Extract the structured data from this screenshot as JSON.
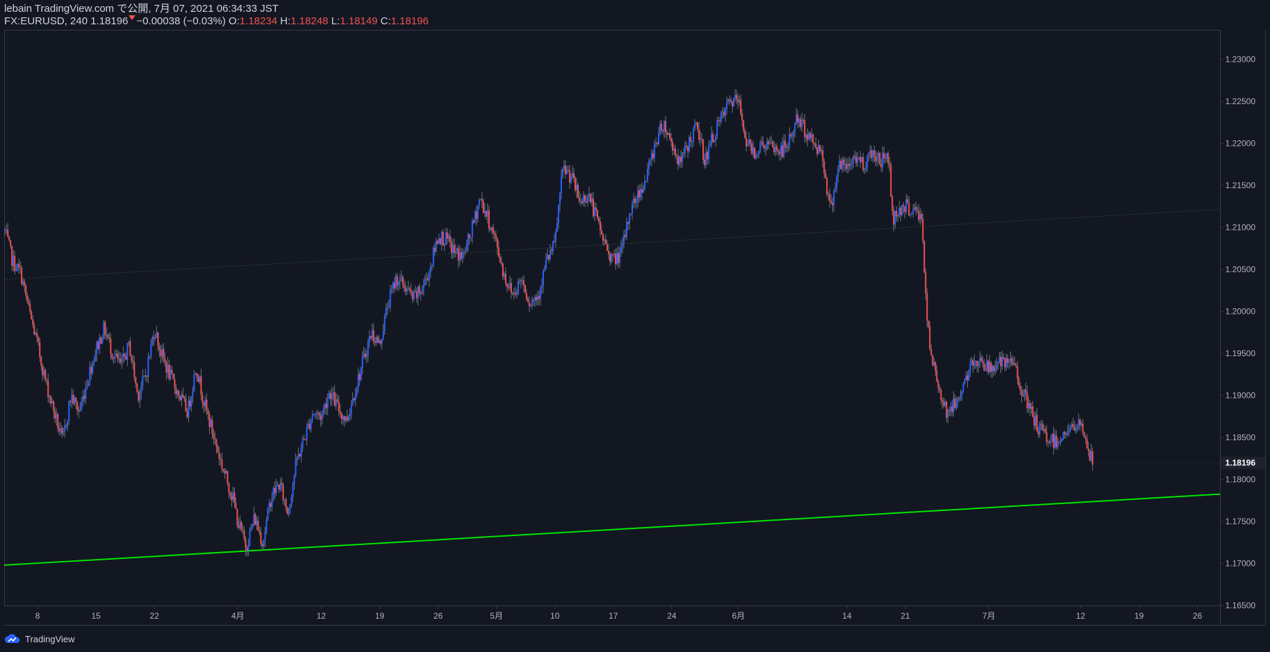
{
  "header": {
    "line1": "lebain TradingView.com で公開, 7月 07, 2021 06:34:33 JST",
    "symbol_prefix": "FX:EURUSD, 240 1.18196",
    "change": "−0.00038 (−0.03%)",
    "o_label": "O:",
    "o_value": "1.18234",
    "h_label": "H:",
    "h_value": "1.18248",
    "l_label": "L:",
    "l_value": "1.18149",
    "c_label": "C:",
    "c_value": "1.18196"
  },
  "footer": {
    "brand": "TradingView"
  },
  "colors": {
    "background": "#131722",
    "up": "#2962ff",
    "down": "#ef5350",
    "trendline": "#00e600",
    "channel_line": "#2e7d32",
    "price_tag": "#1e222d",
    "axis_text": "#b2b5be"
  },
  "chart_data": {
    "type": "candlestick",
    "symbol": "FX:EURUSD",
    "interval": "240",
    "last_price": "1.18196",
    "ylim": [
      1.165,
      1.2335
    ],
    "y_ticks": [
      "1.23000",
      "1.22500",
      "1.22000",
      "1.21500",
      "1.21000",
      "1.20500",
      "1.20000",
      "1.19500",
      "1.19000",
      "1.18500",
      "1.18000",
      "1.17500",
      "1.17000",
      "1.16500"
    ],
    "x_ticks": [
      {
        "label": "8",
        "day": 8
      },
      {
        "label": "15",
        "day": 15
      },
      {
        "label": "22",
        "day": 22
      },
      {
        "label": "4月",
        "day": 32
      },
      {
        "label": "12",
        "day": 42
      },
      {
        "label": "19",
        "day": 49
      },
      {
        "label": "26",
        "day": 56
      },
      {
        "label": "5月",
        "day": 63
      },
      {
        "label": "10",
        "day": 70
      },
      {
        "label": "17",
        "day": 77
      },
      {
        "label": "24",
        "day": 84
      },
      {
        "label": "6月",
        "day": 92
      },
      {
        "label": "14",
        "day": 105
      },
      {
        "label": "21",
        "day": 112
      },
      {
        "label": "7月",
        "day": 122
      },
      {
        "label": "12",
        "day": 133
      },
      {
        "label": "19",
        "day": 140
      },
      {
        "label": "26",
        "day": 147
      }
    ],
    "xlim_days": [
      4,
      149.7
    ],
    "anchors": [
      [
        4.1,
        1.2095
      ],
      [
        5,
        1.206
      ],
      [
        6,
        1.2045
      ],
      [
        7,
        1.2
      ],
      [
        8,
        1.196
      ],
      [
        9,
        1.1915
      ],
      [
        10,
        1.188
      ],
      [
        11,
        1.1845
      ],
      [
        12,
        1.19
      ],
      [
        13,
        1.188
      ],
      [
        14,
        1.192
      ],
      [
        15,
        1.1955
      ],
      [
        16,
        1.198
      ],
      [
        17,
        1.195
      ],
      [
        18,
        1.1935
      ],
      [
        19,
        1.196
      ],
      [
        20,
        1.19
      ],
      [
        21,
        1.1925
      ],
      [
        22,
        1.198
      ],
      [
        22.8,
        1.195
      ],
      [
        24,
        1.192
      ],
      [
        25,
        1.19
      ],
      [
        26,
        1.188
      ],
      [
        27,
        1.1935
      ],
      [
        28,
        1.189
      ],
      [
        29,
        1.1855
      ],
      [
        30,
        1.182
      ],
      [
        31,
        1.179
      ],
      [
        31.5,
        1.1775
      ],
      [
        32,
        1.175
      ],
      [
        33,
        1.172
      ],
      [
        34,
        1.1755
      ],
      [
        35,
        1.1725
      ],
      [
        36,
        1.178
      ],
      [
        37,
        1.1795
      ],
      [
        38,
        1.176
      ],
      [
        39,
        1.182
      ],
      [
        40,
        1.185
      ],
      [
        41,
        1.188
      ],
      [
        42,
        1.1875
      ],
      [
        43,
        1.1905
      ],
      [
        44,
        1.1885
      ],
      [
        45,
        1.187
      ],
      [
        46,
        1.1905
      ],
      [
        47,
        1.194
      ],
      [
        48,
        1.1975
      ],
      [
        49,
        1.196
      ],
      [
        50,
        1.201
      ],
      [
        51,
        1.204
      ],
      [
        52,
        1.203
      ],
      [
        53,
        1.2015
      ],
      [
        54,
        1.2025
      ],
      [
        55,
        1.205
      ],
      [
        56,
        1.209
      ],
      [
        57,
        1.2085
      ],
      [
        58,
        1.207
      ],
      [
        59,
        1.2065
      ],
      [
        60,
        1.2095
      ],
      [
        61,
        1.2135
      ],
      [
        62,
        1.211
      ],
      [
        63,
        1.208
      ],
      [
        64,
        1.204
      ],
      [
        65,
        1.202
      ],
      [
        66,
        1.204
      ],
      [
        67,
        1.201
      ],
      [
        68,
        1.202
      ],
      [
        69,
        1.206
      ],
      [
        70,
        1.208
      ],
      [
        70.5,
        1.213
      ],
      [
        71,
        1.217
      ],
      [
        72,
        1.216
      ],
      [
        73,
        1.213
      ],
      [
        74,
        1.214
      ],
      [
        75,
        1.211
      ],
      [
        76,
        1.208
      ],
      [
        77,
        1.206
      ],
      [
        78,
        1.207
      ],
      [
        79,
        1.212
      ],
      [
        80,
        1.214
      ],
      [
        81,
        1.216
      ],
      [
        82,
        1.22
      ],
      [
        83,
        1.2225
      ],
      [
        84,
        1.22
      ],
      [
        85,
        1.2175
      ],
      [
        86,
        1.22
      ],
      [
        87,
        1.222
      ],
      [
        88,
        1.218
      ],
      [
        89,
        1.221
      ],
      [
        90,
        1.223
      ],
      [
        91,
        1.225
      ],
      [
        92,
        1.225
      ],
      [
        93,
        1.22
      ],
      [
        94,
        1.219
      ],
      [
        95,
        1.22
      ],
      [
        96,
        1.2195
      ],
      [
        97,
        1.219
      ],
      [
        98,
        1.22
      ],
      [
        99,
        1.223
      ],
      [
        100,
        1.2215
      ],
      [
        101,
        1.22
      ],
      [
        102,
        1.219
      ],
      [
        103,
        1.212
      ],
      [
        104,
        1.2175
      ],
      [
        105,
        1.217
      ],
      [
        106,
        1.2185
      ],
      [
        107,
        1.2175
      ],
      [
        108,
        1.219
      ],
      [
        109,
        1.218
      ],
      [
        110,
        1.2185
      ],
      [
        110.5,
        1.2105
      ],
      [
        111,
        1.212
      ],
      [
        112,
        1.2125
      ],
      [
        113,
        1.212
      ],
      [
        114,
        1.211
      ],
      [
        114.5,
        1.2
      ],
      [
        115,
        1.195
      ],
      [
        116,
        1.191
      ],
      [
        117,
        1.188
      ],
      [
        118,
        1.189
      ],
      [
        119,
        1.1915
      ],
      [
        120,
        1.1935
      ],
      [
        121,
        1.1945
      ],
      [
        122,
        1.193
      ],
      [
        123,
        1.194
      ],
      [
        124,
        1.1935
      ],
      [
        125,
        1.194
      ],
      [
        126,
        1.1905
      ],
      [
        127,
        1.188
      ],
      [
        128,
        1.186
      ],
      [
        129,
        1.185
      ],
      [
        130,
        1.1845
      ],
      [
        131,
        1.1855
      ],
      [
        132,
        1.186
      ],
      [
        133,
        1.1865
      ],
      [
        133.5,
        1.1855
      ],
      [
        134,
        1.183
      ],
      [
        134.5,
        1.182
      ]
    ],
    "lines": [
      {
        "name": "support-trendline",
        "from": {
          "day": 4,
          "price": 1.1698
        },
        "to": {
          "day": 149.7,
          "price": 1.17825
        },
        "style": "solid"
      },
      {
        "name": "channel-line",
        "from": {
          "day": 4,
          "price": 1.2038
        },
        "to": {
          "day": 149.7,
          "price": 1.21215
        },
        "style": "dotted"
      }
    ],
    "grid": false
  }
}
